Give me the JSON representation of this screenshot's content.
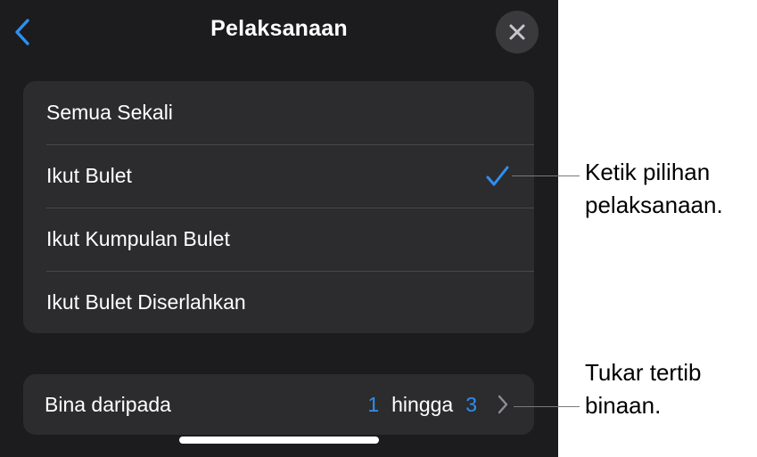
{
  "nav": {
    "title": "Pelaksanaan"
  },
  "options": [
    {
      "label": "Semua Sekali",
      "selected": false
    },
    {
      "label": "Ikut Bulet",
      "selected": true
    },
    {
      "label": "Ikut Kumpulan Bulet",
      "selected": false
    },
    {
      "label": "Ikut Bulet Diserlahkan",
      "selected": false
    }
  ],
  "build": {
    "label": "Bina daripada",
    "from": "1",
    "connector": "hingga",
    "to": "3"
  },
  "callouts": {
    "delivery": "Ketik pilihan\npelaksanaan.",
    "build_order": "Tukar tertib\nbinaan."
  },
  "colors": {
    "panel_bg": "#1c1c1e",
    "group_bg": "#2c2c2e",
    "accent": "#2f8ff0"
  },
  "icons": {
    "back": "chevron-left-icon",
    "close": "close-icon",
    "check": "checkmark-icon",
    "disclosure": "chevron-right-icon"
  }
}
